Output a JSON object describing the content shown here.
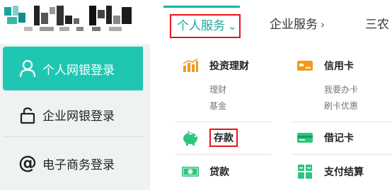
{
  "colors": {
    "accent": "#1fc7b3",
    "accent_text": "#16a99b",
    "highlight": "#e6141a",
    "icon_orange": "#f39a1e",
    "icon_green": "#2ec47d",
    "icon_blue": "#2a9fd8"
  },
  "topnav": {
    "tabs": [
      {
        "label": "个人服务",
        "icon": "chevron-down-icon"
      },
      {
        "label": "企业服务",
        "icon": "chevron-right-icon"
      },
      {
        "label": "三农"
      }
    ]
  },
  "login": {
    "items": [
      {
        "label": "个人网银登录",
        "icon": "user-icon"
      },
      {
        "label": "企业网银登录",
        "icon": "lock-icon"
      },
      {
        "label": "电子商务登录",
        "icon": "at-icon"
      }
    ]
  },
  "menu": {
    "investment": {
      "title": "投资理财",
      "icon": "bar-chart-icon",
      "links": [
        "理财",
        "基金"
      ]
    },
    "credit_card": {
      "title": "信用卡",
      "icon": "credit-card-icon",
      "links": [
        "我要办卡",
        "刷卡优惠"
      ]
    },
    "deposit": {
      "title": "存款",
      "icon": "piggy-bank-icon"
    },
    "debit_card": {
      "title": "借记卡",
      "icon": "debit-card-icon"
    },
    "loan": {
      "title": "贷款",
      "icon": "cash-icon"
    },
    "payment": {
      "title": "支付结算",
      "icon": "payment-icon"
    }
  }
}
